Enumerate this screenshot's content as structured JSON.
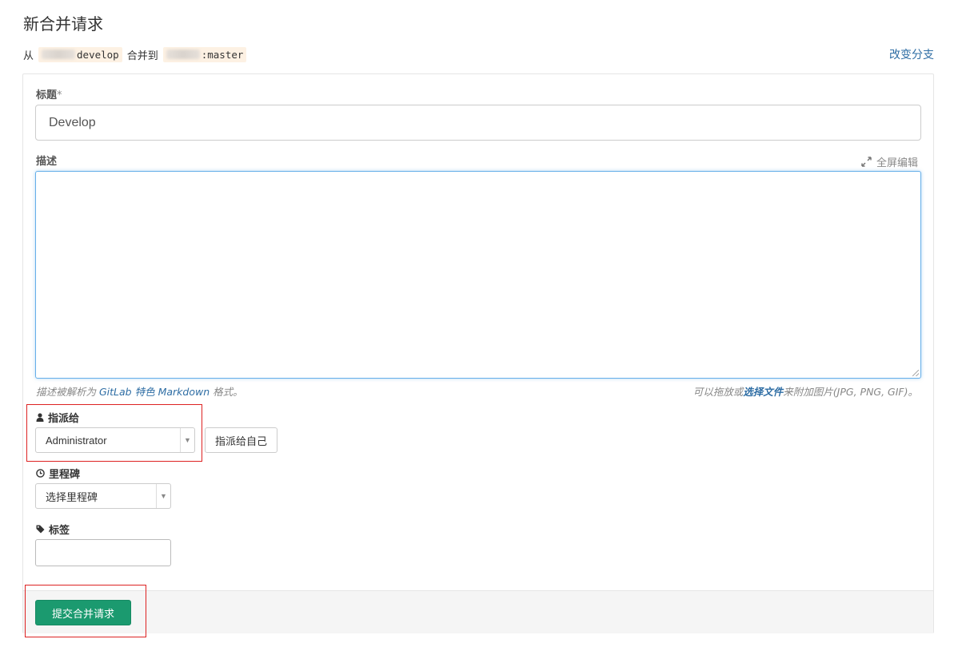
{
  "page": {
    "title": "新合并请求"
  },
  "branch": {
    "from_prefix": "从",
    "source_branch": "develop",
    "merge_into": "合并到",
    "target_branch": ":master",
    "change_branch_link": "改变分支"
  },
  "form": {
    "title_label": "标题",
    "title_required": "*",
    "title_value": "Develop",
    "description_label": "描述",
    "fullscreen_label": "全屏编辑",
    "description_value": "",
    "hint_left_prefix": "描述被解析为",
    "hint_left_link": "GitLab 特色 Markdown",
    "hint_left_suffix": "格式。",
    "hint_right_prefix": "可以拖放或",
    "hint_right_link": "选择文件",
    "hint_right_suffix": "来附加图片(JPG, PNG, GIF)。",
    "assignee_label": "指派给",
    "assignee_value": "Administrator",
    "assign_self_button": "指派给自己",
    "milestone_label": "里程碑",
    "milestone_value": "选择里程碑",
    "labels_label": "标签",
    "labels_value": "",
    "submit_button": "提交合并请求"
  },
  "colors": {
    "link": "#2e6da4",
    "submit_bg": "#1b9a6f",
    "highlight_border": "#dd2222",
    "branch_chip_bg": "#fdf1e3"
  },
  "icons": {
    "assignee": "user-icon",
    "milestone": "clock-icon",
    "labels": "tag-icon",
    "fullscreen": "expand-icon",
    "dropdown": "caret-down-icon"
  }
}
